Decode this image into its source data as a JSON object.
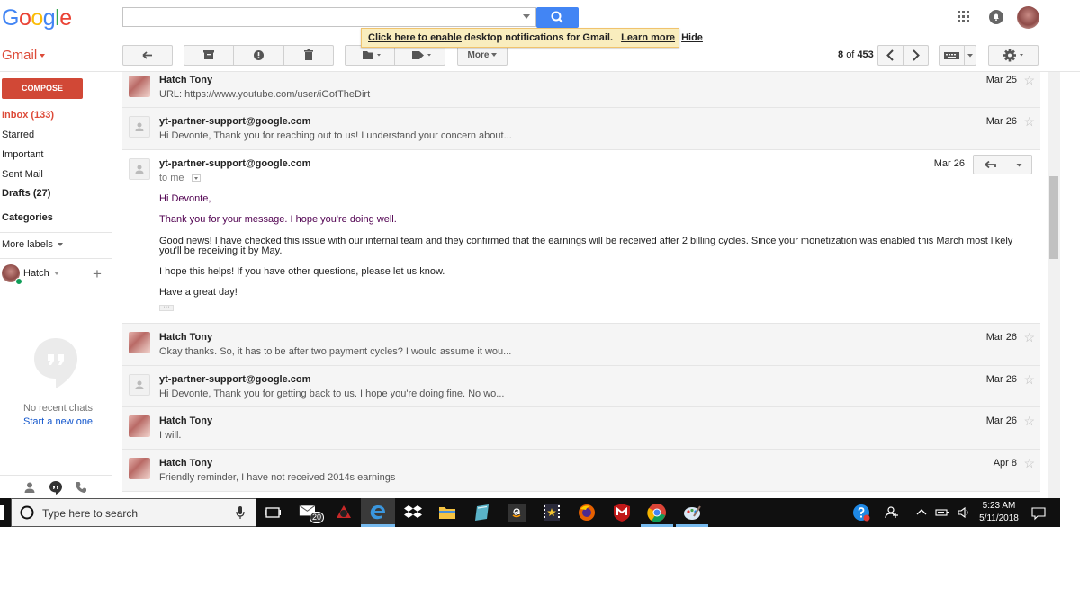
{
  "header": {
    "logo_letters": [
      "G",
      "o",
      "o",
      "g",
      "l",
      "e"
    ],
    "logo_colors": [
      "#4285f4",
      "#ea4335",
      "#fbbc05",
      "#4285f4",
      "#34a853",
      "#ea4335"
    ],
    "search_placeholder": "",
    "notification": {
      "link_text": "Click here to enable",
      "text": "desktop notifications for Gmail.",
      "learn_more": "Learn more",
      "hide": "Hide"
    }
  },
  "toolbar": {
    "app_label": "Gmail",
    "more_label": "More",
    "pager_current": "8",
    "pager_of": "of",
    "pager_total": "453"
  },
  "sidebar": {
    "compose_label": "COMPOSE",
    "items": [
      {
        "label": "Inbox (133)"
      },
      {
        "label": "Starred"
      },
      {
        "label": "Important"
      },
      {
        "label": "Sent Mail"
      },
      {
        "label": "Drafts (27)"
      }
    ],
    "categories_label": "Categories",
    "more_labels": "More labels",
    "hangouts_user": "Hatch",
    "no_chats": "No recent chats",
    "start_new": "Start a new one"
  },
  "thread": [
    {
      "sender": "Hatch Tony",
      "snippet": "URL: https://www.youtube.com/user/iGotTheDirt",
      "date": "Mar 25",
      "avatar": "photo"
    },
    {
      "sender": "yt-partner-support@google.com",
      "snippet": "Hi Devonte, Thank you for reaching out to us! I understand your concern about...",
      "date": "Mar 26",
      "avatar": "generic"
    },
    {
      "sender": "yt-partner-support@google.com",
      "date": "Mar 26",
      "avatar": "generic",
      "to_line": "to me",
      "body": [
        "Hi Devonte,",
        "Thank you for your message. I hope you're doing well.",
        "Good news! I have checked this issue with our internal team and they confirmed that the earnings will be received after 2 billing cycles. Since your monetization was enabled this March most likely you'll be receiving it by May.",
        "I hope this helps! If you have other questions, please let us know.",
        "Have a great day!"
      ],
      "ellipsis": "···"
    },
    {
      "sender": "Hatch Tony",
      "snippet": "Okay thanks. So, it has to be after two payment cycles? I would assume it wou...",
      "date": "Mar 26",
      "avatar": "photo"
    },
    {
      "sender": "yt-partner-support@google.com",
      "snippet": "Hi Devonte, Thank you for getting back to us. I hope you're doing fine. No wo...",
      "date": "Mar 26",
      "avatar": "generic"
    },
    {
      "sender": "Hatch Tony",
      "snippet": "I will.",
      "date": "Mar 26",
      "avatar": "photo"
    },
    {
      "sender": "Hatch Tony",
      "snippet": "Friendly reminder, I have not received 2014s earnings",
      "date": "Apr 8",
      "avatar": "photo"
    }
  ],
  "taskbar": {
    "search_placeholder": "Type here to search",
    "mail_badge": "20",
    "time": "5:23 AM",
    "date": "5/11/2018"
  }
}
